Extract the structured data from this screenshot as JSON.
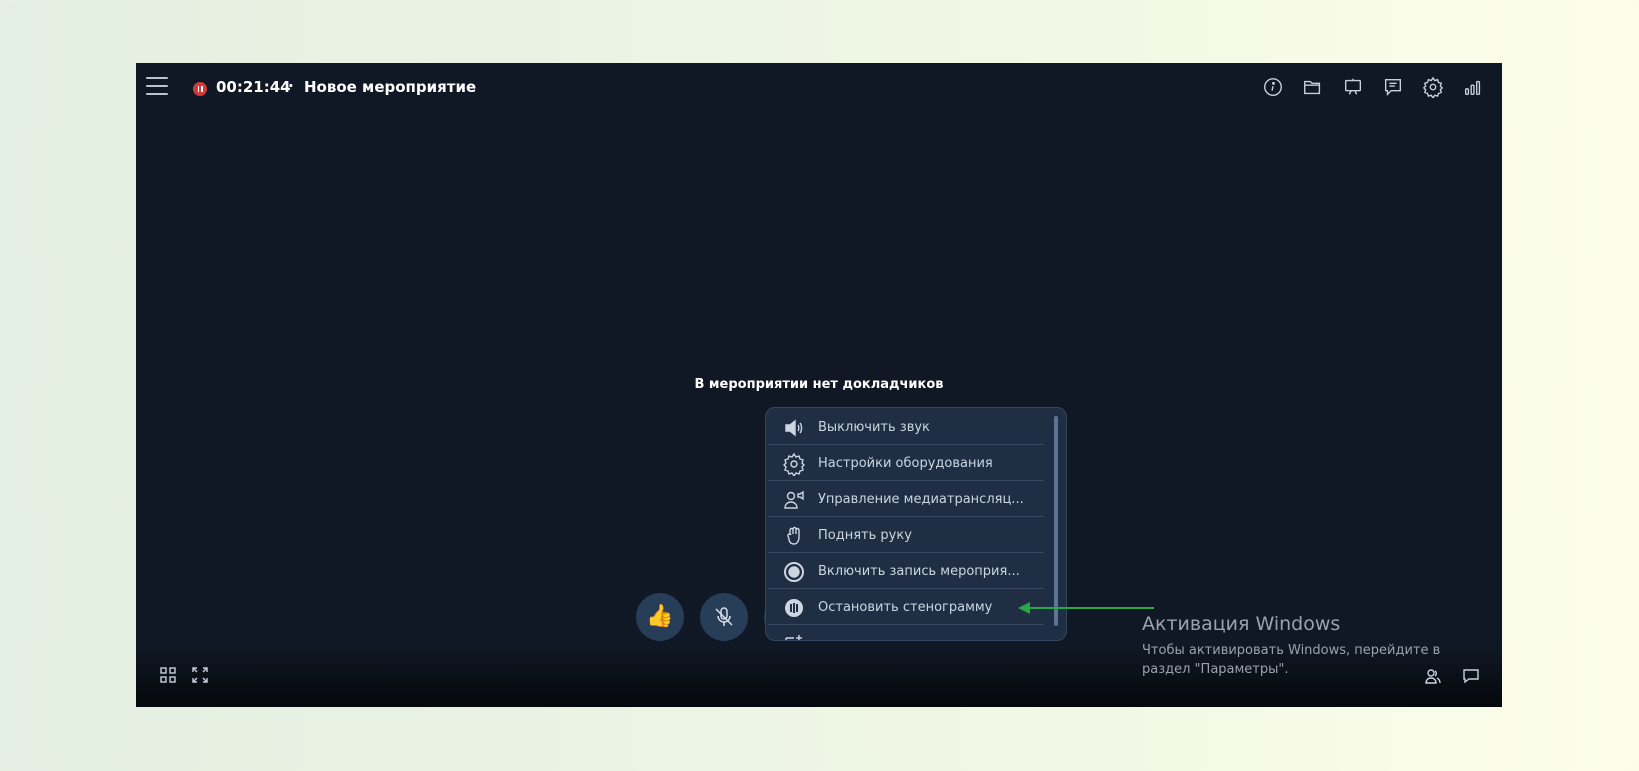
{
  "header": {
    "timer": "00:21:44",
    "separator": "·",
    "title": "Новое мероприятие",
    "icons": [
      "info-icon",
      "folder-icon",
      "presentation-board-icon",
      "chat-list-icon",
      "gear-icon",
      "signal-bars-icon"
    ]
  },
  "main": {
    "no_speakers_text": "В мероприятии нет докладчиков"
  },
  "menu": {
    "items": [
      {
        "label": "Выключить звук",
        "icon": "speaker-icon"
      },
      {
        "label": "Настройки оборудования",
        "icon": "gear-icon"
      },
      {
        "label": "Управление медиатрансляц...",
        "icon": "media-broadcast-icon"
      },
      {
        "label": "Поднять руку",
        "icon": "raise-hand-icon"
      },
      {
        "label": "Включить запись мероприя...",
        "icon": "record-icon"
      },
      {
        "label": "Остановить стенограмму",
        "icon": "stop-transcript-icon"
      },
      {
        "label": "",
        "icon": "add-icon"
      }
    ]
  },
  "controls": {
    "buttons": [
      "thumbs-up-button",
      "microphone-button",
      "camera-button",
      "share-screen-button",
      "more-button",
      "hangup-button"
    ],
    "hangup_color": "#d23435",
    "button_color": "#283d58"
  },
  "watermark": {
    "title": "Активация Windows",
    "text": "Чтобы активировать Windows, перейдите в раздел \"Параметры\"."
  },
  "annotation": {
    "arrow_color": "#28a745"
  }
}
